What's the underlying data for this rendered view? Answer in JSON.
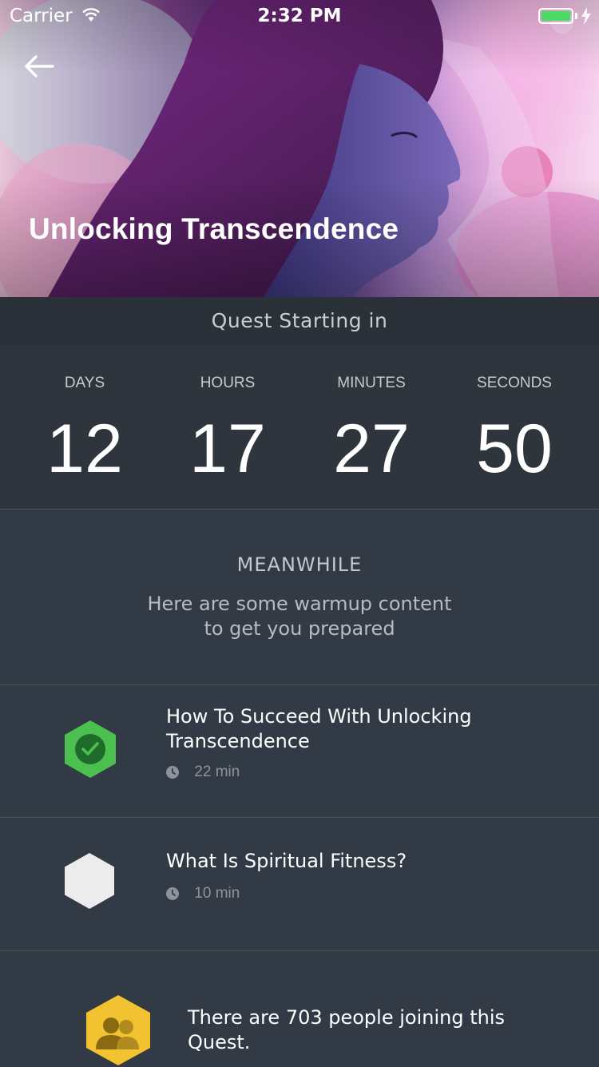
{
  "status_bar": {
    "carrier": "Carrier",
    "time": "2:32 PM",
    "battery_color": "#4cd964"
  },
  "header": {
    "back_icon": "back-arrow-icon",
    "title": "Unlocking Transcendence"
  },
  "countdown_bar": {
    "label": "Quest Starting in"
  },
  "countdown": [
    {
      "label": "DAYS",
      "value": "12"
    },
    {
      "label": "HOURS",
      "value": "17"
    },
    {
      "label": "MINUTES",
      "value": "27"
    },
    {
      "label": "SECONDS",
      "value": "50"
    }
  ],
  "meanwhile": {
    "title": "MEANWHILE",
    "subtitle_line1": "Here are some warmup content",
    "subtitle_line2": "to get you prepared"
  },
  "content_items": [
    {
      "title_line1": "How To Succeed With Unlocking",
      "title_line2": "Transcendence",
      "duration": "22 min",
      "status": "completed",
      "icon": "check-hexagon-icon",
      "icon_color": "#4cc04f"
    },
    {
      "title_line1": "What Is Spiritual Fitness?",
      "duration": "10 min",
      "status": "not-started",
      "icon": "hexagon-icon",
      "icon_color": "#ececec"
    }
  ],
  "participants": {
    "text_line1": "There are 703 people joining this",
    "text_line2": "Quest.",
    "icon": "people-hexagon-icon",
    "icon_color": "#f2c230"
  },
  "colors": {
    "background": "#323b45",
    "countdown_bg": "#2e353d",
    "bar_bg": "#2b3138",
    "divider": "#4a525b"
  }
}
